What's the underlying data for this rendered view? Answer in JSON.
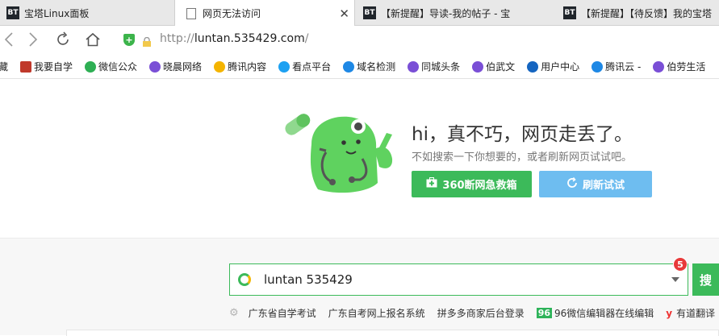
{
  "tabs": [
    {
      "label": "宝塔Linux面板",
      "favicon": "BT"
    },
    {
      "label": "网页无法访问"
    },
    {
      "label": "【新提醒】导读-我的帖子 - 宝",
      "favicon": "BT"
    },
    {
      "label": "【新提醒】【待反馈】我的宝塔",
      "favicon": "BT"
    }
  ],
  "address": {
    "prefix": "http://",
    "host": "luntan.535429.com",
    "suffix": "/"
  },
  "bookmarks": [
    {
      "label": "藏",
      "icon": "folder-icon"
    },
    {
      "label": "我要自学",
      "icon": "book-icon",
      "color": "#c0392b"
    },
    {
      "label": "微信公众",
      "icon": "recycle-icon",
      "color": "#2eaf54"
    },
    {
      "label": "晓晨网络",
      "icon": "globe-icon",
      "color": "#7a4fd6"
    },
    {
      "label": "腾讯内容",
      "icon": "bell-icon",
      "color": "#f4b400"
    },
    {
      "label": "看点平台",
      "icon": "penguin-icon",
      "color": "#1da1f2"
    },
    {
      "label": "域名检测",
      "icon": "cloud-icon",
      "color": "#1e88e5"
    },
    {
      "label": "同城头条",
      "icon": "globe-icon",
      "color": "#7a4fd6"
    },
    {
      "label": "伯武文",
      "icon": "globe-icon",
      "color": "#7a4fd6"
    },
    {
      "label": "用户中心",
      "icon": "ie-icon",
      "color": "#1565c0"
    },
    {
      "label": "腾讯云 -",
      "icon": "cloud-icon",
      "color": "#1e88e5"
    },
    {
      "label": "伯劳生活",
      "icon": "globe-icon",
      "color": "#7a4fd6"
    }
  ],
  "error": {
    "title": "hi，真不巧，网页走丢了。",
    "subtitle": "不如搜索一下你想要的，或者刷新网页试试吧。",
    "rescue_button": "360断网急救箱",
    "refresh_button": "刷新试试"
  },
  "search": {
    "value": "luntan 535429",
    "badge": "5",
    "button": "搜"
  },
  "hotlinks": [
    "广东省自学考试",
    "广东自考网上报名系统",
    "拼多多商家后台登录",
    "96微信编辑器在线编辑",
    "有道翻译"
  ],
  "hotlink_prefixes": {
    "wechat_editor": "96",
    "youdao": "y"
  },
  "colors": {
    "accent_green": "#3cba5a",
    "refresh_blue": "#6ebdf0",
    "badge_red": "#e83a3a"
  }
}
